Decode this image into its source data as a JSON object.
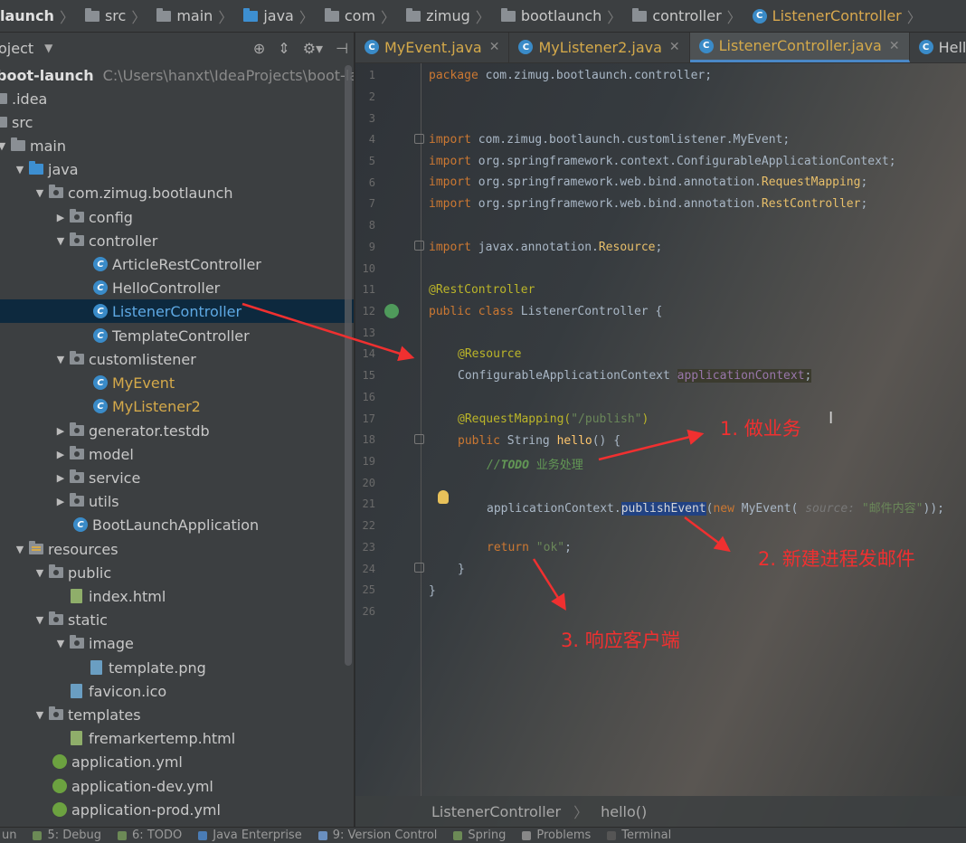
{
  "navbar": {
    "items": [
      "launch",
      "src",
      "main",
      "java",
      "com",
      "zimug",
      "bootlaunch",
      "controller",
      "ListenerController"
    ]
  },
  "project": {
    "title": "oject",
    "tree": [
      {
        "label": "boot-launch",
        "path": "C:\\Users\\hanxt\\IdeaProjects\\boot-launch"
      },
      {
        "label": ".idea"
      },
      {
        "label": "src"
      },
      {
        "label": "main"
      },
      {
        "label": "java"
      },
      {
        "label": "com.zimug.bootlaunch"
      },
      {
        "label": "config"
      },
      {
        "label": "controller"
      },
      {
        "label": "ArticleRestController"
      },
      {
        "label": "HelloController"
      },
      {
        "label": "ListenerController"
      },
      {
        "label": "TemplateController"
      },
      {
        "label": "customlistener"
      },
      {
        "label": "MyEvent"
      },
      {
        "label": "MyListener2"
      },
      {
        "label": "generator.testdb"
      },
      {
        "label": "model"
      },
      {
        "label": "service"
      },
      {
        "label": "utils"
      },
      {
        "label": "BootLaunchApplication"
      },
      {
        "label": "resources"
      },
      {
        "label": "public"
      },
      {
        "label": "index.html"
      },
      {
        "label": "static"
      },
      {
        "label": "image"
      },
      {
        "label": "template.png"
      },
      {
        "label": "favicon.ico"
      },
      {
        "label": "templates"
      },
      {
        "label": "fremarkertemp.html"
      },
      {
        "label": "application.yml"
      },
      {
        "label": "application-dev.yml"
      },
      {
        "label": "application-prod.yml"
      }
    ]
  },
  "tabs": [
    {
      "label": "MyEvent.java"
    },
    {
      "label": "MyListener2.java"
    },
    {
      "label": "ListenerController.java"
    },
    {
      "label": "HelloCont"
    }
  ],
  "editor": {
    "line_numbers": [
      "1",
      "2",
      "3",
      "4",
      "5",
      "6",
      "7",
      "8",
      "9",
      "10",
      "11",
      "12",
      "13",
      "14",
      "15",
      "16",
      "17",
      "18",
      "19",
      "20",
      "21",
      "22",
      "23",
      "24",
      "25",
      "26"
    ],
    "code": {
      "l1_kw": "package",
      "l1_rest": " com.zimug.bootlaunch.controller;",
      "l4_kw": "import",
      "l4_rest": " com.zimug.bootlaunch.customlistener.MyEvent;",
      "l5_kw": "import",
      "l5_rest": " org.springframework.context.ConfigurableApplicationContext;",
      "l6_kw": "import",
      "l6_rest": " org.springframework.web.bind.annotation.",
      "l6_cls": "RequestMapping",
      "l6_end": ";",
      "l7_kw": "import",
      "l7_rest": " org.springframework.web.bind.annotation.",
      "l7_cls": "RestController",
      "l7_end": ";",
      "l9_kw": "import",
      "l9_rest": " javax.annotation.",
      "l9_cls": "Resource",
      "l9_end": ";",
      "l11_an": "@RestController",
      "l12_kw": "public class",
      "l12_rest": " ListenerController {",
      "l14_an": "@Resource",
      "l15_type": "ConfigurableApplicationContext ",
      "l15_field": "applicationContext",
      "l15_end": ";",
      "l17_an": "@RequestMapping(",
      "l17_str": "\"/publish\"",
      "l17_end": ")",
      "l18_kw": "public",
      "l18_type": " String ",
      "l18_fn": "hello",
      "l18_end": "() {",
      "l19_cm": "//",
      "l19_todo": "TODO",
      "l19_text": " 业务处理",
      "l21_a": "applicationContext.",
      "l21_fn": "publishEvent",
      "l21_b": "(",
      "l21_kw": "new",
      "l21_c": " MyEvent( ",
      "l21_hint": "source:",
      "l21_str": " \"邮件内容\"",
      "l21_end": "));",
      "l23_kw": "return",
      "l23_str": " \"ok\"",
      "l23_end": ";",
      "l24": "}",
      "l25": "}"
    },
    "breadcrumb": {
      "cls": "ListenerController",
      "method": "hello()"
    }
  },
  "annotations": {
    "n1": "1. 做业务",
    "n2": "2. 新建进程发邮件",
    "n3": "3. 响应客户端"
  },
  "toolbar": {
    "items": [
      "un",
      "5: Debug",
      "6: TODO",
      "Java Enterprise",
      "9: Version Control",
      "Spring",
      "Problems",
      "Terminal"
    ]
  },
  "colors": {
    "accent": "#4a88c7",
    "annotation": "#f03030",
    "selection": "#0d293e"
  }
}
